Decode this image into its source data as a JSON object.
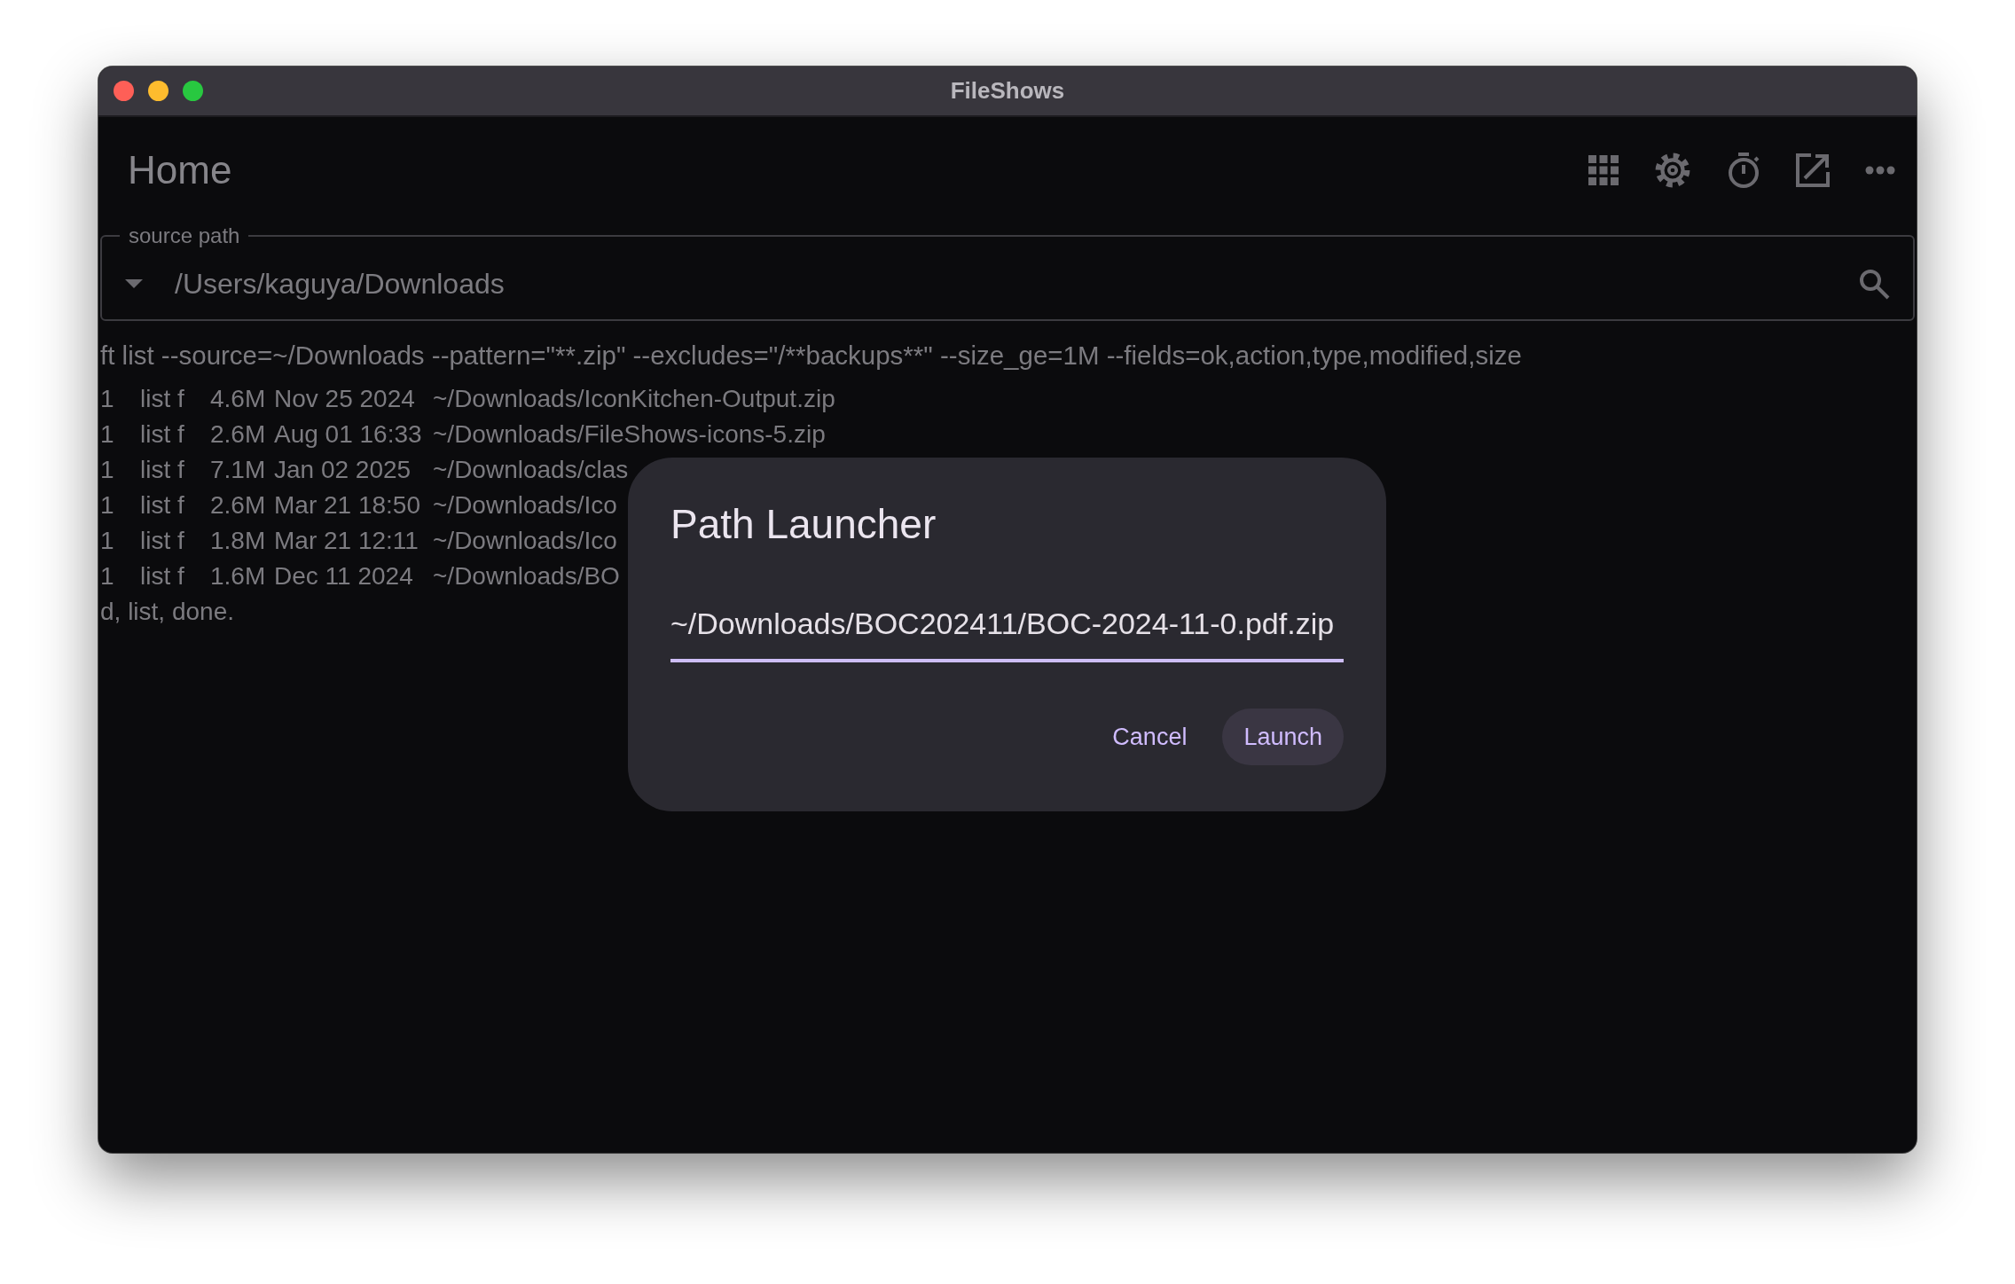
{
  "window": {
    "title": "FileShows"
  },
  "header": {
    "title": "Home"
  },
  "source_field": {
    "label": "source path",
    "value": "/Users/kaguya/Downloads"
  },
  "log": {
    "command": "ft list  --source=~/Downloads --pattern=\"**.zip\" --excludes=\"/**backups**\" --size_ge=1M --fields=ok,action,type,modified,size",
    "rows": [
      {
        "ok": "1",
        "action": "list f",
        "size": "4.6M",
        "modified": "Nov 25 2024",
        "path": "~/Downloads/IconKitchen-Output.zip"
      },
      {
        "ok": "1",
        "action": "list f",
        "size": "2.6M",
        "modified": "Aug 01 16:33",
        "path": "~/Downloads/FileShows-icons-5.zip"
      },
      {
        "ok": "1",
        "action": "list f",
        "size": "7.1M",
        "modified": "Jan 02 2025",
        "path": "~/Downloads/clas"
      },
      {
        "ok": "1",
        "action": "list f",
        "size": "2.6M",
        "modified": "Mar 21 18:50",
        "path": "~/Downloads/Ico"
      },
      {
        "ok": "1",
        "action": "list f",
        "size": "1.8M",
        "modified": "Mar 21 12:11",
        "path": "~/Downloads/Ico"
      },
      {
        "ok": "1",
        "action": "list f",
        "size": "1.6M",
        "modified": "Dec 11 2024",
        "path": "~/Downloads/BO"
      }
    ],
    "status": "d, list, done."
  },
  "dialog": {
    "title": "Path Launcher",
    "value": "~/Downloads/BOC202411/BOC-2024-11-0.pdf.zip",
    "buttons": [
      "Cancel",
      "Launch"
    ]
  }
}
